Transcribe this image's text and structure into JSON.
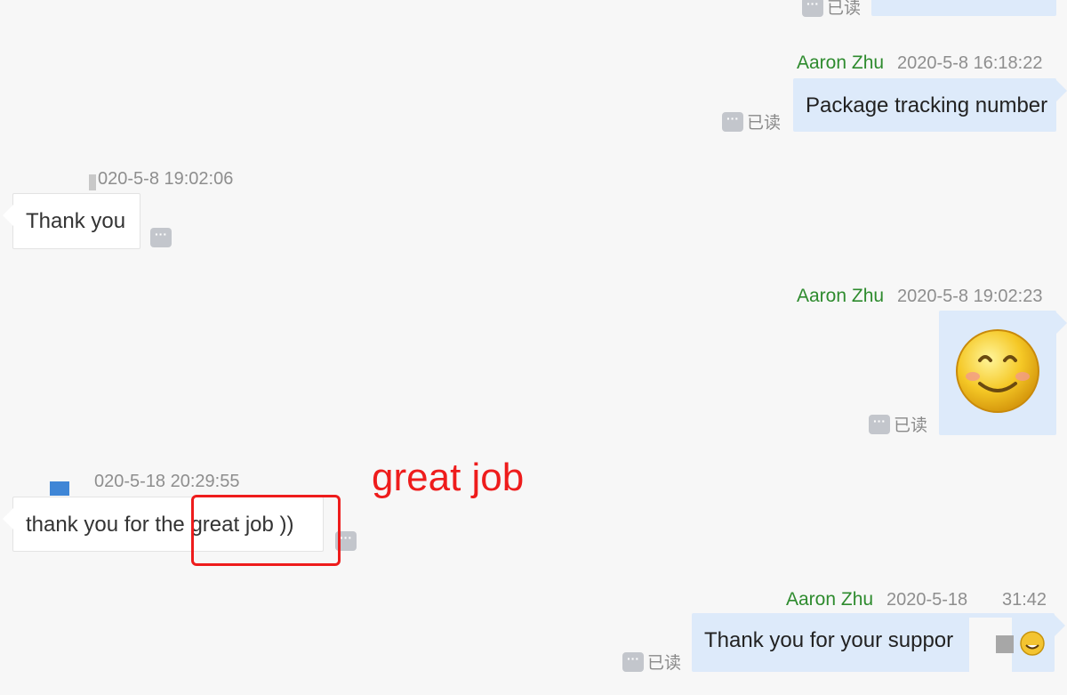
{
  "colors": {
    "sender_name": "#2e8b2e",
    "outgoing_bubble": "#ddeafa",
    "incoming_bubble": "#ffffff",
    "annotation": "#ee1c1c",
    "background": "#f7f7f7"
  },
  "read_status": "已读",
  "more_icon": "···",
  "messages": [
    {
      "direction": "outgoing",
      "sender": "Aaron Zhu",
      "time": "2020-5-8 16:18:22",
      "text": "Package tracking number"
    },
    {
      "direction": "incoming",
      "time": "020-5-8 19:02:06",
      "text": "Thank you"
    },
    {
      "direction": "outgoing",
      "sender": "Aaron Zhu",
      "time": "2020-5-8 19:02:23",
      "emoji": "smiley-emoji"
    },
    {
      "direction": "incoming",
      "time": "020-5-18 20:29:55",
      "text": "thank you for the great job ))"
    },
    {
      "direction": "outgoing",
      "sender": "Aaron Zhu",
      "time_visible": "2020-5-18",
      "time_tail": "31:42",
      "text": "Thank you for your suppor"
    }
  ],
  "annotation": {
    "label": "great job"
  }
}
